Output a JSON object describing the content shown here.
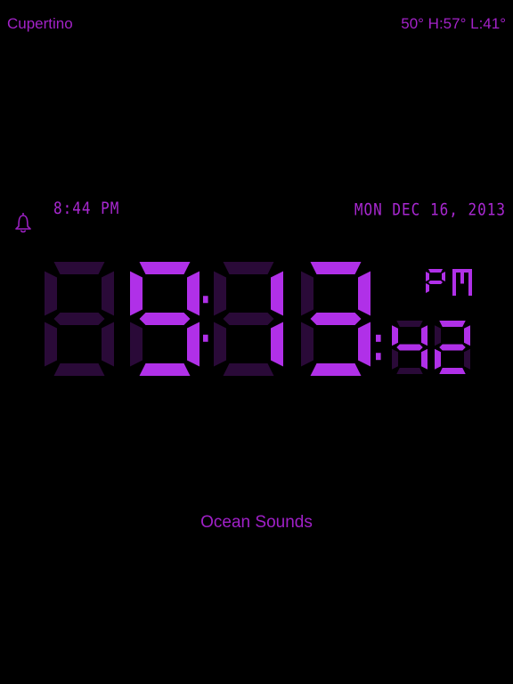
{
  "header": {
    "location": "Cupertino",
    "weather": "50° H:57° L:41°"
  },
  "alarm": {
    "icon": "bell-icon",
    "time": "8:44 PM"
  },
  "date": {
    "text": "MON DEC 16, 2013"
  },
  "clock": {
    "digits": [
      "8",
      "9",
      "1",
      "3"
    ],
    "lit_digits": [
      "",
      "9",
      "1",
      "3"
    ],
    "seconds": "42",
    "period": "PM",
    "color_lit": "#b030e8",
    "color_dim": "#2a0a38"
  },
  "sound": {
    "label": "Ocean Sounds"
  }
}
